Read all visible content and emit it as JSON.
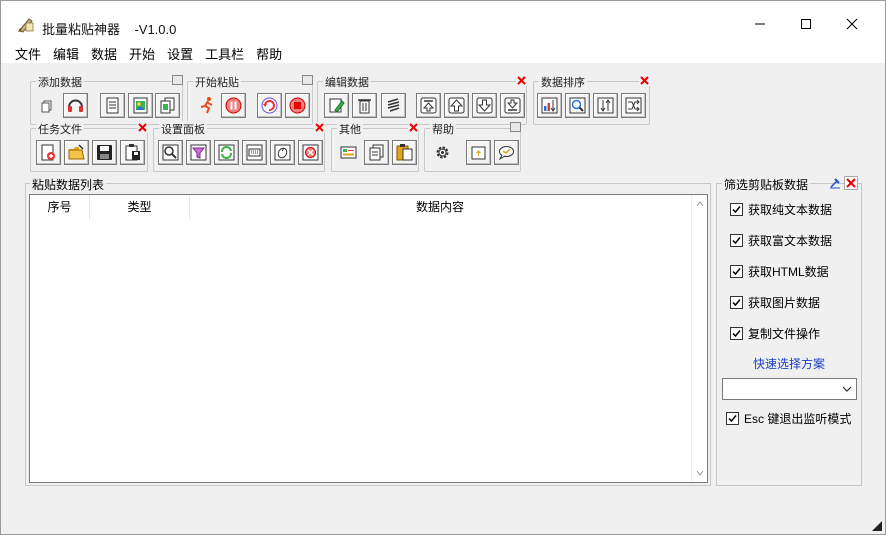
{
  "window": {
    "title": "批量粘贴神器    -V1.0.0"
  },
  "menu": [
    "文件",
    "编辑",
    "数据",
    "开始",
    "设置",
    "工具栏",
    "帮助"
  ],
  "toolbars": {
    "add_data": {
      "label": "添加数据"
    },
    "start_paste": {
      "label": "开始粘贴"
    },
    "edit_data": {
      "label": "编辑数据"
    },
    "sort_data": {
      "label": "数据排序"
    },
    "task_file": {
      "label": "任务文件"
    },
    "settings_panel": {
      "label": "设置面板"
    },
    "other": {
      "label": "其他"
    },
    "help": {
      "label": "帮助"
    }
  },
  "list": {
    "label": "粘贴数据列表",
    "columns": [
      "序号",
      "类型",
      "数据内容"
    ]
  },
  "filter": {
    "title": "筛选剪贴板数据",
    "options": [
      {
        "label": "获取纯文本数据",
        "checked": true
      },
      {
        "label": "获取富文本数据",
        "checked": true
      },
      {
        "label": "获取HTML数据",
        "checked": true
      },
      {
        "label": "获取图片数据",
        "checked": true
      },
      {
        "label": "复制文件操作",
        "checked": true
      }
    ],
    "quick_select": "快速选择方案",
    "combo_value": "",
    "esc_option": {
      "label": "Esc 键退出监听模式",
      "checked": true
    }
  },
  "colors": {
    "link": "#1a3ec4",
    "close_red": "#e00000",
    "pin_blue": "#1f4fd6"
  }
}
